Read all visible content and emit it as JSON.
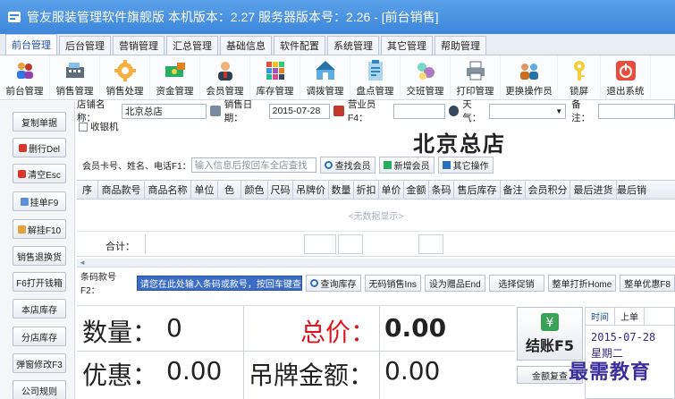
{
  "window": {
    "title": "管友服装管理软件旗舰版 本机版本：2.27 服务器版本号：2.26 - [前台销售]"
  },
  "menu_tabs": [
    "前台管理",
    "后台管理",
    "营销管理",
    "汇总管理",
    "基础信息",
    "软件配置",
    "系统管理",
    "其它管理",
    "帮助管理"
  ],
  "toolbar": [
    {
      "label": "前台管理",
      "icon": "user-group-icon"
    },
    {
      "label": "销售管理",
      "icon": "register-icon"
    },
    {
      "label": "销售处理",
      "icon": "gear-icon"
    },
    {
      "label": "资金管理",
      "icon": "money-icon"
    },
    {
      "label": "会员管理",
      "icon": "member-icon"
    },
    {
      "label": "库存管理",
      "icon": "grid-icon"
    },
    {
      "label": "调拨管理",
      "icon": "transfer-icon"
    },
    {
      "label": "盘点管理",
      "icon": "clipboard-icon"
    },
    {
      "label": "交班管理",
      "icon": "handover-icon"
    },
    {
      "label": "打印管理",
      "icon": "printer-icon"
    },
    {
      "label": "更换操作员",
      "icon": "switch-user-icon"
    },
    {
      "label": "锁屏",
      "icon": "key-icon"
    },
    {
      "label": "退出系统",
      "icon": "power-icon"
    }
  ],
  "left_buttons": [
    "复制单据",
    "删行Del",
    "清空Esc",
    "挂单F9",
    "解挂F10",
    "销售退换货",
    "F6打开钱箱",
    "本店库存",
    "分店库存",
    "弹窗修改F3",
    "公司规则"
  ],
  "form": {
    "store_label": "店铺名称：",
    "store_value": "北京总店",
    "date_label": "销售日期：",
    "date_value": "2015-07-28",
    "clerk_label": "营业员F4：",
    "clerk_value": "",
    "weather_label": "天气：",
    "weather_value": "",
    "note_label": "备注：",
    "note_value": "",
    "cashier_label": "收银机"
  },
  "store_title": "北京总店",
  "member_search": {
    "label": "会员卡号、姓名、电话F1：",
    "placeholder": "输入信息后按回车全店查找",
    "find_button": "查找会员",
    "add_button": "新增会员",
    "other_button": "其它操作"
  },
  "table": {
    "columns": [
      "序",
      "商品款号",
      "商品名称",
      "单位",
      "色",
      "颜色",
      "尺码",
      "吊牌价",
      "数量",
      "折扣",
      "单价",
      "金额",
      "条码",
      "售后库存",
      "备注",
      "会员积分",
      "最后进货",
      "最后销"
    ],
    "empty_text": "<无数据显示>",
    "total_label": "合计："
  },
  "barcode": {
    "label": "条码款号F2：",
    "placeholder": "请您在此处输入条码或款号，按回车键查找",
    "buttons": [
      "查询库存",
      "无码销售Ins",
      "设为赠品End",
      "选择促销",
      "整单打折Home",
      "整单优惠F8"
    ]
  },
  "summary": {
    "qty_label": "数量：",
    "qty_value": "0",
    "total_label": "总价：",
    "total_value": "0.00",
    "discount_label": "优惠：",
    "discount_value": "0.00",
    "tag_label": "吊牌金额：",
    "tag_value": "0.00"
  },
  "checkout": {
    "label": "结账F5",
    "recheck": "金额复查"
  },
  "side_panel": {
    "tabs": [
      "时间",
      "上单"
    ],
    "date": "2015-07-28",
    "weekday": "星期二"
  },
  "watermark": "最需教育",
  "colors": {
    "title_bar": "#4a93e2",
    "total_price": "#e0141e",
    "barcode_highlight": "#3b6cc6",
    "watermark": "#3b2f9e"
  }
}
